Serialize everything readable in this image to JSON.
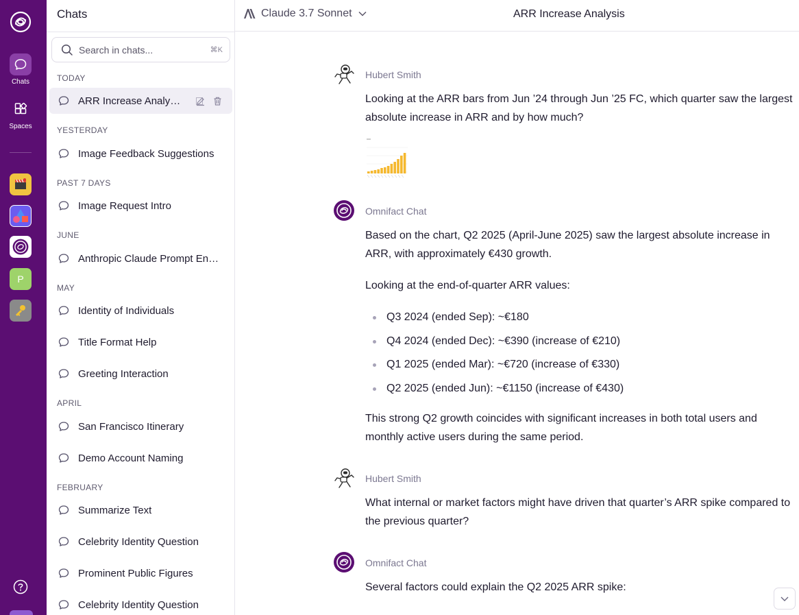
{
  "rail": {
    "items": [
      {
        "label": "Chats",
        "icon": "chat-bubble-icon",
        "active": true
      },
      {
        "label": "Spaces",
        "icon": "grid-icon",
        "active": false
      }
    ],
    "app_tiles": [
      {
        "icon": "clapperboard-icon",
        "color": "#f0c341"
      },
      {
        "icon": "shapes-app-icon",
        "color": "#ffffff"
      },
      {
        "icon": "omnifact-logo-icon",
        "color": "#ffffff"
      },
      {
        "icon": "letter-p-icon",
        "label": "P",
        "color": "#9ed36a"
      },
      {
        "icon": "key-icon",
        "color": "#8a8a8a"
      }
    ],
    "help_icon": "help-circle-icon"
  },
  "sidebar": {
    "title": "Chats",
    "search_placeholder": "Search in chats...",
    "search_shortcut": "⌘K",
    "groups": [
      {
        "label": "TODAY",
        "items": [
          "ARR Increase Analysis"
        ]
      },
      {
        "label": "YESTERDAY",
        "items": [
          "Image Feedback Suggestions"
        ]
      },
      {
        "label": "PAST 7 DAYS",
        "items": [
          "Image Request Intro"
        ]
      },
      {
        "label": "JUNE",
        "items": [
          "Anthropic Claude Prompt Engineering"
        ]
      },
      {
        "label": "MAY",
        "items": [
          "Identity of Individuals",
          "Title Format Help",
          "Greeting Interaction"
        ]
      },
      {
        "label": "APRIL",
        "items": [
          "San Francisco Itinerary",
          "Demo Account Naming"
        ]
      },
      {
        "label": "FEBRUARY",
        "items": [
          "Summarize Text",
          "Celebrity Identity Question",
          "Prominent Public Figures",
          "Celebrity Identity Question"
        ]
      }
    ]
  },
  "topbar": {
    "model_name": "Claude 3.7 Sonnet",
    "title": "ARR Increase Analysis"
  },
  "messages": [
    {
      "author": "Hubert Smith",
      "text": "Looking at the ARR bars from Jun ’24 through Jun ’25 FC, which quarter saw the largest absolute increase in ARR and by how much?"
    },
    {
      "author": "Omnifact Chat",
      "paragraph1": "Based on the chart, Q2 2025 (April-June 2025) saw the largest absolute increase in ARR, with approximately €430 growth.",
      "paragraph2": "Looking at the end-of-quarter ARR values:",
      "bullets": [
        "Q3 2024 (ended Sep): ~€180",
        "Q4 2024 (ended Dec): ~€390 (increase of €210)",
        "Q1 2025 (ended Mar): ~€720 (increase of €330)",
        "Q2 2025 (ended Jun): ~€1150 (increase of €430)"
      ],
      "paragraph3": "This strong Q2 growth coincides with significant increases in both total users and monthly active users during the same period."
    },
    {
      "author": "Hubert Smith",
      "text": "What internal or market factors might have driven that quarter’s ARR spike compared to the previous quarter?"
    },
    {
      "author": "Omnifact Chat",
      "text": "Several factors could explain the Q2 2025 ARR spike:"
    }
  ],
  "colors": {
    "rail_bg": "#5b0e72",
    "rail_active": "#8a3fa6",
    "bar_color": "#f5b82e",
    "active_chat_bg": "#f0eef5"
  }
}
